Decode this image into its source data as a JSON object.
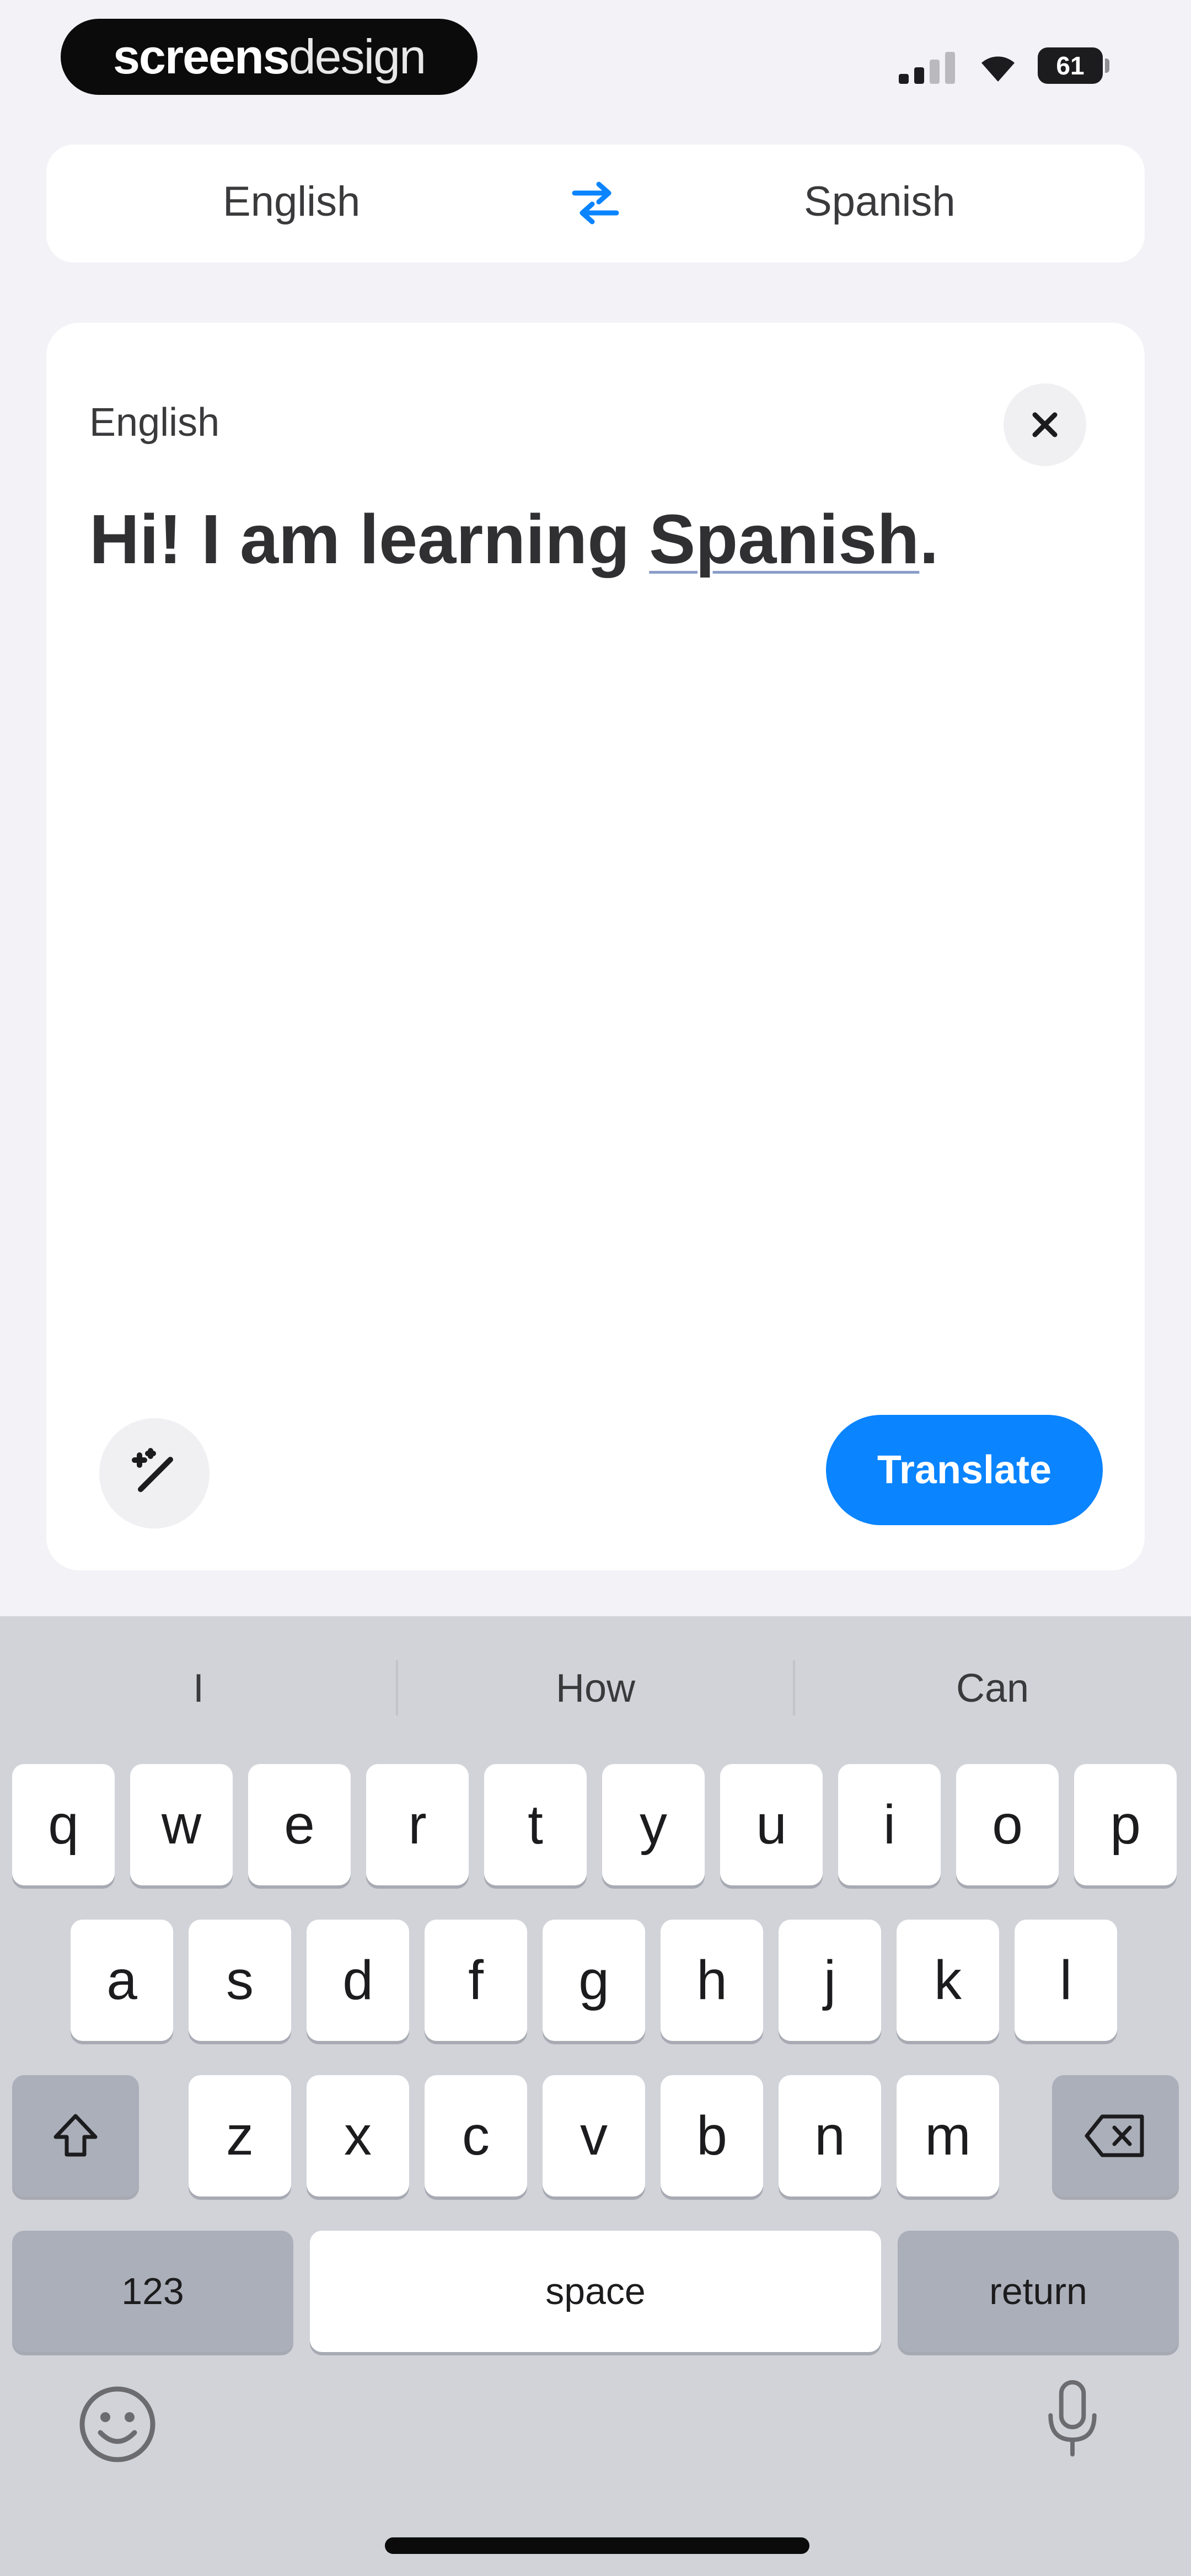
{
  "status_bar": {
    "brand_bold": "screens",
    "brand_light": "design",
    "battery": "61"
  },
  "language_bar": {
    "source": "English",
    "target": "Spanish",
    "swap_icon": "swap-arrows-icon"
  },
  "input_card": {
    "language_label": "English",
    "text_part1": "Hi! I am learning ",
    "text_part2_underlined": "Spanish",
    "text_part3": ".",
    "translate_label": "Translate"
  },
  "keyboard": {
    "suggestions": [
      "I",
      "How",
      "Can"
    ],
    "row1": [
      "q",
      "w",
      "e",
      "r",
      "t",
      "y",
      "u",
      "i",
      "o",
      "p"
    ],
    "row2": [
      "a",
      "s",
      "d",
      "f",
      "g",
      "h",
      "j",
      "k",
      "l"
    ],
    "row3": [
      "z",
      "x",
      "c",
      "v",
      "b",
      "n",
      "m"
    ],
    "numbers_label": "123",
    "space_label": "space",
    "return_label": "return"
  },
  "colors": {
    "accent": "#0a84ff",
    "background": "#f2f2f7",
    "keyboard_bg": "#d1d3d9"
  }
}
